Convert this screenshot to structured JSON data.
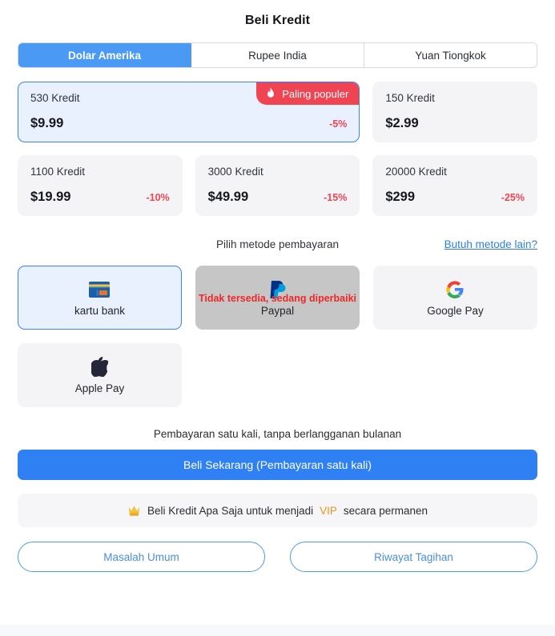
{
  "header": {
    "title": "Beli Kredit"
  },
  "currency_tabs": [
    {
      "label": "Dolar Amerika",
      "active": true
    },
    {
      "label": "Rupee India",
      "active": false
    },
    {
      "label": "Yuan Tiongkok",
      "active": false
    }
  ],
  "packages": [
    {
      "credits": "530 Kredit",
      "price": "$9.99",
      "discount": "-5%",
      "badge": "Paling populer",
      "selected": true,
      "wide": true
    },
    {
      "credits": "150 Kredit",
      "price": "$2.99",
      "discount": "",
      "badge": "",
      "selected": false,
      "wide": false
    },
    {
      "credits": "1100 Kredit",
      "price": "$19.99",
      "discount": "-10%",
      "badge": "",
      "selected": false,
      "wide": false
    },
    {
      "credits": "3000 Kredit",
      "price": "$49.99",
      "discount": "-15%",
      "badge": "",
      "selected": false,
      "wide": false
    },
    {
      "credits": "20000 Kredit",
      "price": "$299",
      "discount": "-25%",
      "badge": "",
      "selected": false,
      "wide": false
    }
  ],
  "payment": {
    "section_title": "Pilih metode pembayaran",
    "other_methods_link": "Butuh metode lain?",
    "methods": [
      {
        "label": "kartu bank",
        "icon": "credit-card-icon",
        "selected": true,
        "disabled": false,
        "unavailable_text": ""
      },
      {
        "label": "Paypal",
        "icon": "paypal-icon",
        "selected": false,
        "disabled": true,
        "unavailable_text": "Tidak tersedia, sedang diperbaiki"
      },
      {
        "label": "Google Pay",
        "icon": "google-pay-icon",
        "selected": false,
        "disabled": false,
        "unavailable_text": ""
      },
      {
        "label": "Apple Pay",
        "icon": "apple-pay-icon",
        "selected": false,
        "disabled": false,
        "unavailable_text": ""
      }
    ]
  },
  "purchase": {
    "note": "Pembayaran satu kali, tanpa berlangganan bulanan",
    "cta_label": "Beli Sekarang (Pembayaran satu kali)"
  },
  "vip_banner": {
    "icon": "crown-icon",
    "text_before": "Beli Kredit Apa Saja untuk menjadi",
    "highlight": "VIP",
    "text_after": "secara permanen"
  },
  "footer_buttons": [
    {
      "label": "Masalah Umum"
    },
    {
      "label": "Riwayat Tagihan"
    }
  ],
  "colors": {
    "accent_blue": "#2f80f2",
    "tab_active": "#4a9af5",
    "badge_red": "#f04452",
    "discount_red": "#f04452",
    "vip_orange": "#f0941e",
    "link_blue": "#2f7fe0"
  }
}
